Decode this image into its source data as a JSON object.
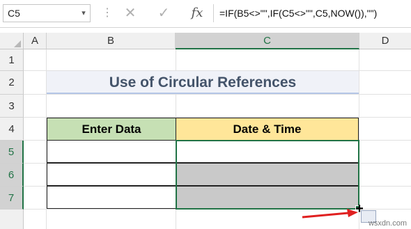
{
  "formula_bar": {
    "name_box": "C5",
    "formula": "=IF(B5<>\"\",IF(C5<>\"\",C5,NOW()),\"\")",
    "fx_label": "fx",
    "cancel_glyph": "✕",
    "enter_glyph": "✓"
  },
  "columns": [
    "A",
    "B",
    "C",
    "D"
  ],
  "rows": [
    "1",
    "2",
    "3",
    "4",
    "5",
    "6",
    "7"
  ],
  "title": "Use of Circular References",
  "table": {
    "headers": [
      "Enter Data",
      "Date & Time"
    ]
  },
  "watermark": "wsxdn.com",
  "colors": {
    "accent": "#217346",
    "header_green": "#c6e0b4",
    "header_yellow": "#ffe699",
    "arrow_red": "#e02020"
  },
  "icons": [
    "chevron-down-icon",
    "cancel-icon",
    "enter-icon",
    "fx-icon",
    "crosshair-cursor-icon",
    "quick-analysis-icon"
  ]
}
